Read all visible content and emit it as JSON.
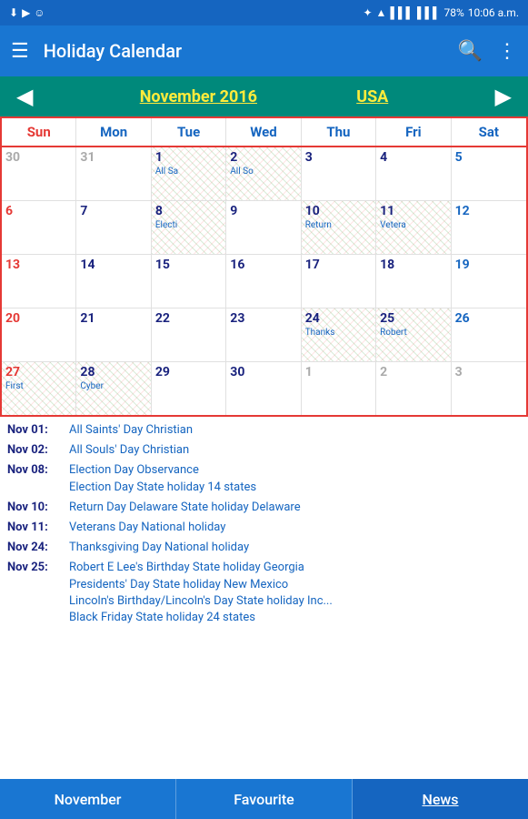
{
  "statusBar": {
    "leftIcons": [
      "⬇",
      "▶",
      "☺"
    ],
    "bluetooth": "✦",
    "wifi": "WiFi",
    "signal1": "▌▌▌",
    "signal2": "▌▌▌",
    "battery": "78%",
    "time": "10:06 a.m."
  },
  "appBar": {
    "title": "Holiday Calendar",
    "searchLabel": "🔍",
    "moreLabel": "⋮"
  },
  "monthNav": {
    "prevLabel": "◀",
    "nextLabel": "▶",
    "monthTitle": "November 2016",
    "country": "USA"
  },
  "dayHeaders": [
    "Sun",
    "Mon",
    "Tue",
    "Wed",
    "Thu",
    "Fri",
    "Sat"
  ],
  "weeks": [
    [
      {
        "date": "30",
        "otherMonth": true,
        "events": []
      },
      {
        "date": "31",
        "otherMonth": true,
        "events": []
      },
      {
        "date": "1",
        "events": [
          "All Sa"
        ],
        "holiday": true
      },
      {
        "date": "2",
        "events": [
          "All So"
        ],
        "holiday": true
      },
      {
        "date": "3",
        "events": [],
        "holiday": false
      },
      {
        "date": "4",
        "events": [],
        "holiday": false
      },
      {
        "date": "5",
        "events": [],
        "holiday": false
      }
    ],
    [
      {
        "date": "6",
        "events": []
      },
      {
        "date": "7",
        "events": []
      },
      {
        "date": "8",
        "events": [
          "Electi"
        ],
        "holiday": true
      },
      {
        "date": "9",
        "events": []
      },
      {
        "date": "10",
        "events": [
          "Return"
        ],
        "holiday": true
      },
      {
        "date": "11",
        "events": [
          "Vetera"
        ],
        "holiday": true
      },
      {
        "date": "12",
        "events": []
      }
    ],
    [
      {
        "date": "13",
        "events": []
      },
      {
        "date": "14",
        "events": []
      },
      {
        "date": "15",
        "events": []
      },
      {
        "date": "16",
        "events": []
      },
      {
        "date": "17",
        "events": []
      },
      {
        "date": "18",
        "events": []
      },
      {
        "date": "19",
        "events": []
      }
    ],
    [
      {
        "date": "20",
        "events": []
      },
      {
        "date": "21",
        "events": []
      },
      {
        "date": "22",
        "events": []
      },
      {
        "date": "23",
        "events": []
      },
      {
        "date": "24",
        "events": [
          "Thanks"
        ],
        "holiday": true
      },
      {
        "date": "25",
        "events": [
          "Robert"
        ],
        "holiday": true
      },
      {
        "date": "26",
        "events": []
      }
    ],
    [
      {
        "date": "27",
        "events": [
          "First"
        ],
        "holiday": true
      },
      {
        "date": "28",
        "events": [
          "Cyber"
        ],
        "holiday": true
      },
      {
        "date": "29",
        "events": []
      },
      {
        "date": "30",
        "events": []
      },
      {
        "date": "1",
        "otherMonth": true,
        "events": []
      },
      {
        "date": "2",
        "otherMonth": true,
        "events": []
      },
      {
        "date": "3",
        "otherMonth": true,
        "events": []
      }
    ]
  ],
  "holidays": [
    {
      "date": "Nov 01:",
      "desc": "All Saints' Day Christian"
    },
    {
      "date": "Nov 02:",
      "desc": "All Souls' Day Christian"
    },
    {
      "date": "Nov 08:",
      "desc": "Election Day Observance\nElection Day State holiday 14 states"
    },
    {
      "date": "Nov 10:",
      "desc": "Return Day Delaware State holiday Delaware"
    },
    {
      "date": "Nov 11:",
      "desc": "Veterans Day National holiday"
    },
    {
      "date": "Nov 24:",
      "desc": "Thanksgiving Day National holiday"
    },
    {
      "date": "Nov 25:",
      "desc": "Robert E Lee's Birthday State holiday Georgia\nPresidents' Day State holiday New Mexico\nLincoln's Birthday/Lincoln's Day State holiday Inc...\nBlack Friday State holiday 24 states"
    }
  ],
  "bottomNav": {
    "items": [
      "November",
      "Favourite",
      "News"
    ],
    "activeIndex": 2
  }
}
